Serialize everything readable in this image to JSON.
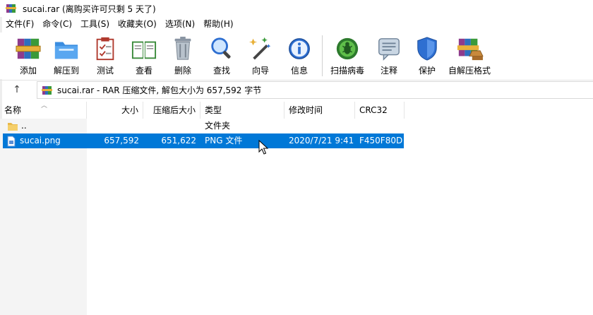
{
  "window": {
    "title": "sucai.rar (离购买许可只剩 5 天了)"
  },
  "menu": [
    "文件(F)",
    "命令(C)",
    "工具(S)",
    "收藏夹(O)",
    "选项(N)",
    "帮助(H)"
  ],
  "toolbar": [
    {
      "label": "添加",
      "icon": "add-archive-icon"
    },
    {
      "label": "解压到",
      "icon": "extract-to-icon"
    },
    {
      "label": "测试",
      "icon": "test-icon"
    },
    {
      "label": "查看",
      "icon": "view-book-icon"
    },
    {
      "label": "删除",
      "icon": "trash-icon"
    },
    {
      "label": "查找",
      "icon": "magnifier-icon"
    },
    {
      "label": "向导",
      "icon": "wizard-wand-icon"
    },
    {
      "label": "信息",
      "icon": "info-icon"
    },
    {
      "label": "扫描病毒",
      "icon": "virus-scan-icon"
    },
    {
      "label": "注释",
      "icon": "comment-icon"
    },
    {
      "label": "保护",
      "icon": "shield-icon"
    },
    {
      "label": "自解压格式",
      "icon": "sfx-icon"
    }
  ],
  "address": {
    "up": "↑",
    "text": "sucai.rar - RAR 压缩文件, 解包大小为 657,592 字节"
  },
  "columns": [
    "名称",
    "大小",
    "压缩后大小",
    "类型",
    "修改时间",
    "CRC32"
  ],
  "rows": [
    {
      "name": "..",
      "size": "",
      "packed": "",
      "type": "文件夹",
      "modified": "",
      "crc": "",
      "icon": "folder-icon",
      "selected": false
    },
    {
      "name": "sucai.png",
      "size": "657,592",
      "packed": "651,622",
      "type": "PNG 文件",
      "modified": "2020/7/21 9:41",
      "crc": "F450F80D",
      "icon": "png-file-icon",
      "selected": true
    }
  ],
  "colors": {
    "selection": "#0078d7",
    "accent_red": "#c0392b",
    "accent_blue": "#2e6fd1"
  }
}
